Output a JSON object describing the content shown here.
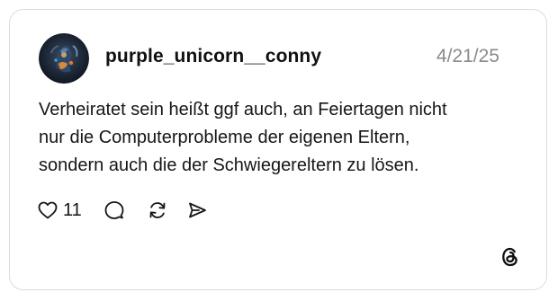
{
  "post": {
    "username": "purple_unicorn__conny",
    "date": "4/21/25",
    "text_lines": [
      "Verheiratet sein heißt ggf auch, an Feiertagen nicht",
      "nur die Computerprobleme der eigenen Eltern,",
      "sondern auch die der Schwiegereltern zu lösen."
    ],
    "likes": "11"
  },
  "icons": {
    "like": "heart-icon",
    "reply": "comment-icon",
    "repost": "repost-icon",
    "share": "send-icon",
    "logo": "threads-logo-icon"
  }
}
